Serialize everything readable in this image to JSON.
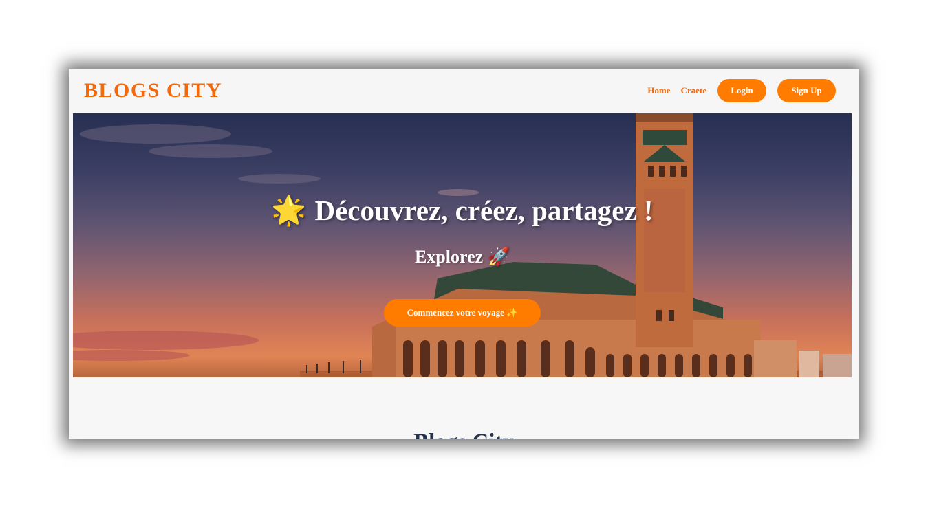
{
  "nav": {
    "brand": "BLOGS CITY",
    "links": [
      {
        "label": "Home"
      },
      {
        "label": "Craete"
      }
    ],
    "login_label": "Login",
    "signup_label": "Sign Up"
  },
  "hero": {
    "title_icon": "🌟",
    "title": "Découvrez, créez, partagez !",
    "subtitle": "Explorez 🚀",
    "cta_label": "Commencez votre voyage ✨",
    "background_image": "hassan-ii-mosque-sunset"
  },
  "section": {
    "title": "Blogs City"
  },
  "colors": {
    "accent": "#ff7c00",
    "brand": "#f26a0e",
    "heading": "#25344a"
  }
}
